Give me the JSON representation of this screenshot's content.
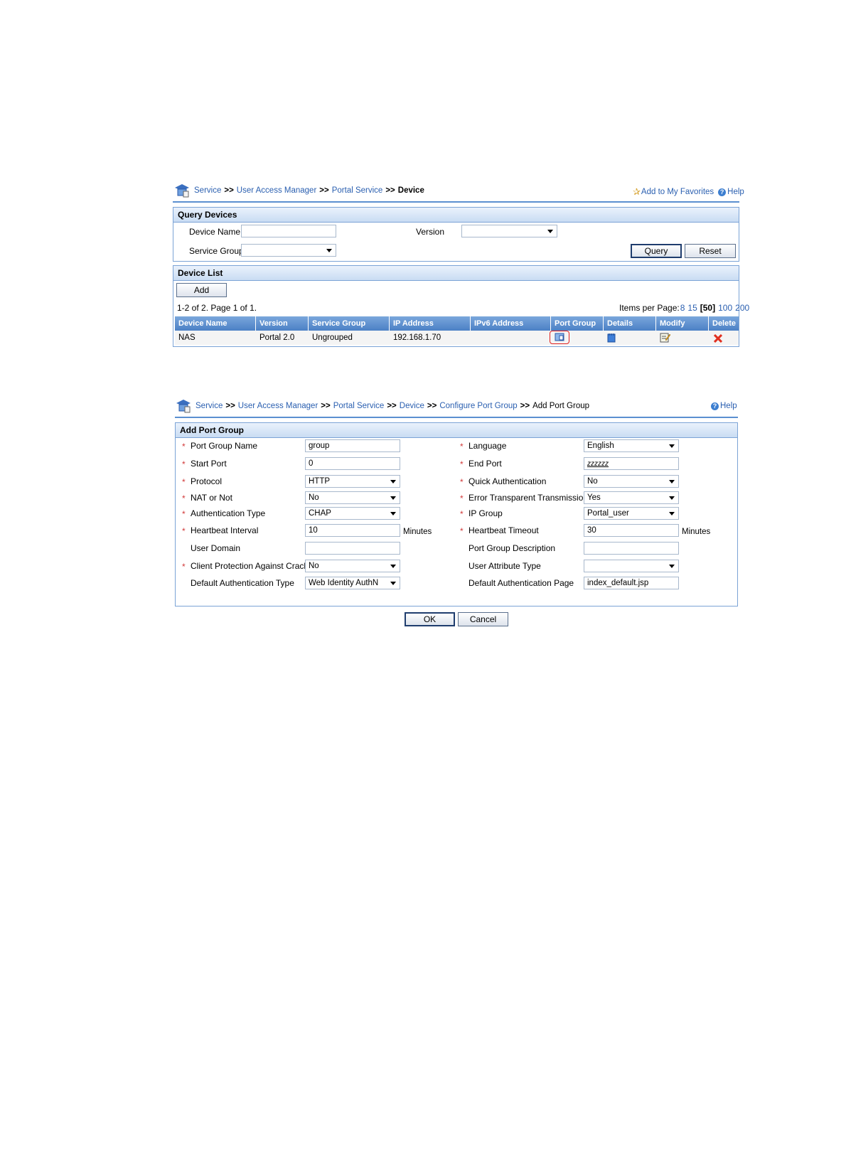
{
  "screen1": {
    "breadcrumb": [
      "Service",
      "User Access Manager",
      "Portal Service"
    ],
    "breadcrumb_current": "Device",
    "separator": ">>",
    "favorites_label": "Add to My Favorites",
    "help_label": "Help",
    "query_panel": {
      "title": "Query Devices",
      "device_name_label": "Device Name",
      "device_name_value": "",
      "version_label": "Version",
      "version_value": "",
      "service_group_label": "Service Group",
      "service_group_value": "",
      "query_button": "Query",
      "reset_button": "Reset"
    },
    "list_panel": {
      "title": "Device List",
      "add_button": "Add",
      "paging_text": "1-2 of 2. Page 1 of 1.",
      "items_per_page_label": "Items per Page:",
      "page_sizes": [
        "8",
        "15",
        "[50]",
        "100",
        "200"
      ],
      "columns": [
        "Device Name",
        "Version",
        "Service Group",
        "IP Address",
        "IPv6 Address",
        "Port Group",
        "Details",
        "Modify",
        "Delete"
      ],
      "rows": [
        {
          "device_name": "NAS",
          "version": "Portal 2.0",
          "service_group": "Ungrouped",
          "ip": "192.168.1.70",
          "ipv6": ""
        }
      ]
    }
  },
  "screen2": {
    "breadcrumb": [
      "Service",
      "User Access Manager",
      "Portal Service",
      "Device",
      "Configure Port Group"
    ],
    "breadcrumb_current": "Add Port Group",
    "separator": ">>",
    "help_label": "Help",
    "form": {
      "title": "Add Port Group",
      "required_mark": "*",
      "minutes_label": "Minutes",
      "port_group_name": {
        "label": "Port Group Name",
        "value": "group"
      },
      "language": {
        "label": "Language",
        "value": "English"
      },
      "start_port": {
        "label": "Start Port",
        "value": "0"
      },
      "end_port": {
        "label": "End Port",
        "value": "zzzzzz"
      },
      "protocol": {
        "label": "Protocol",
        "value": "HTTP"
      },
      "quick_auth": {
        "label": "Quick Authentication",
        "value": "No"
      },
      "nat": {
        "label": "NAT or Not",
        "value": "No"
      },
      "error_transparent": {
        "label": "Error Transparent Transmission",
        "value": "Yes"
      },
      "auth_type": {
        "label": "Authentication Type",
        "value": "CHAP"
      },
      "ip_group": {
        "label": "IP Group",
        "value": "Portal_user"
      },
      "heartbeat_interval": {
        "label": "Heartbeat Interval",
        "value": "10"
      },
      "heartbeat_timeout": {
        "label": "Heartbeat Timeout",
        "value": "30"
      },
      "user_domain": {
        "label": "User Domain",
        "value": ""
      },
      "port_group_desc": {
        "label": "Port Group Description",
        "value": ""
      },
      "client_protection": {
        "label": "Client Protection Against Cracks",
        "value": "No"
      },
      "user_attr_type": {
        "label": "User Attribute Type",
        "value": ""
      },
      "default_auth_type": {
        "label": "Default Authentication Type",
        "value": "Web Identity AuthN"
      },
      "default_auth_page": {
        "label": "Default Authentication Page",
        "value": "index_default.jsp"
      }
    },
    "ok_button": "OK",
    "cancel_button": "Cancel"
  },
  "colors": {
    "link": "#2a5fb0",
    "header": "#4b80c5",
    "required": "#d23a3a",
    "highlight": "#e02020"
  }
}
